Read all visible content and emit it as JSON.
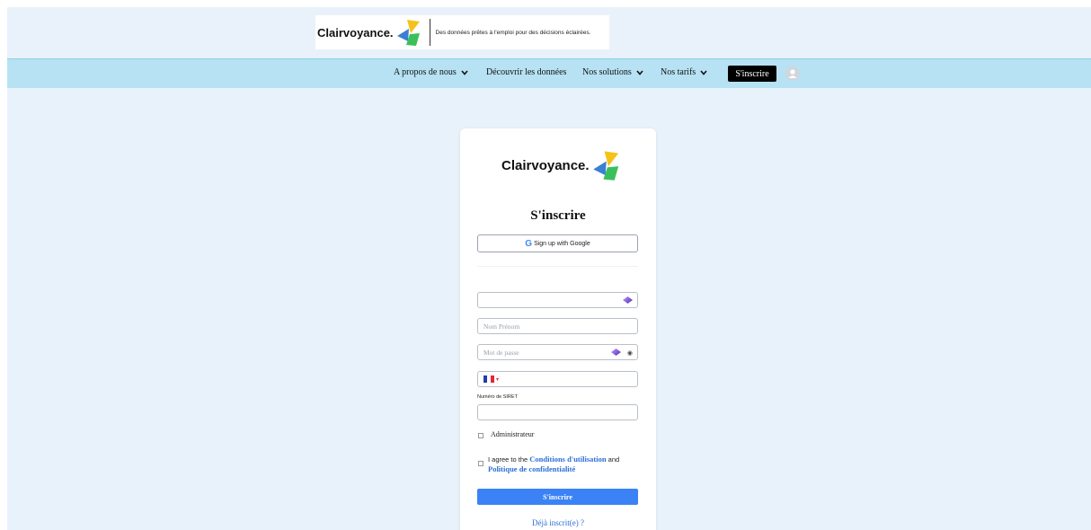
{
  "brand": {
    "name": "Clairvoyance.",
    "tagline": "Des données prêtes à l'emploi pour des décisions éclairées."
  },
  "nav": {
    "items": [
      {
        "label": "A propos de nous",
        "dropdown": true
      },
      {
        "label": "Découvrir les données",
        "dropdown": false
      },
      {
        "label": "Nos solutions",
        "dropdown": true
      },
      {
        "label": "Nos tarifs",
        "dropdown": true
      }
    ],
    "signup_label": "S'inscrire",
    "avatar_icon": "user-avatar-icon"
  },
  "form": {
    "title": "S'inscrire",
    "google_label": "Sign up with Google",
    "email_placeholder": "",
    "name_placeholder": "Nom Prénom",
    "password_placeholder": "Mot de passe",
    "phone_country": "FR",
    "siret_label": "Numéro de SIRET",
    "siret_value": "",
    "admin_label": "Administrateur",
    "agree_prefix": "I agree to the",
    "terms_link": "Conditions d'utilisation",
    "agree_and": "and",
    "privacy_link": "Politique de confidentialité",
    "submit_label": "S'inscrire",
    "login_link": "Déjà inscrit(e) ?"
  },
  "colors": {
    "page_bg": "#e8f2fb",
    "nav_bg": "#b6e2f3",
    "accent": "#3b82f6",
    "link": "#2c6fd6",
    "logo_yellow": "#f5c318",
    "logo_blue": "#3a7fd5",
    "logo_green": "#3bbf5a"
  }
}
